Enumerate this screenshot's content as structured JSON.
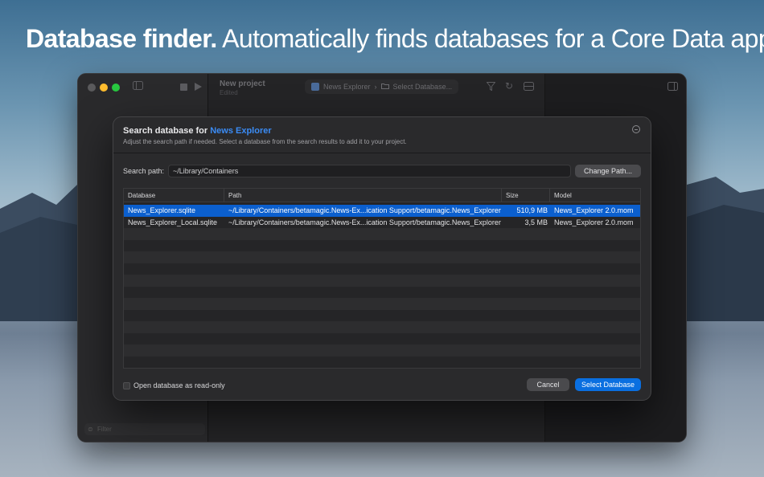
{
  "headline": {
    "bold": "Database finder.",
    "rest": "Automatically finds databases for a Core Data app."
  },
  "window": {
    "project_title": "New project",
    "project_status": "Edited",
    "breadcrumb_app": "News Explorer",
    "breadcrumb_page": "Select Database...",
    "filter_placeholder": "Filter",
    "ghost_text": "ed"
  },
  "sheet": {
    "title_prefix": "Search database for",
    "title_app": "News Explorer",
    "description": "Adjust the search path if needed. Select a database from the search results to add it to your project.",
    "search_label": "Search path:",
    "search_value": "~/Library/Containers",
    "change_path_label": "Change Path...",
    "columns": [
      "Database",
      "Path",
      "Size",
      "Model"
    ],
    "rows": [
      {
        "database": "News_Explorer.sqlite",
        "path": "~/Library/Containers/betamagic.News-Ex...ication Support/betamagic.News_Explorer",
        "size": "510,9 MB",
        "model": "News_Explorer 2.0.mom"
      },
      {
        "database": "News_Explorer_Local.sqlite",
        "path": "~/Library/Containers/betamagic.News-Ex...ication Support/betamagic.News_Explorer",
        "size": "3,5 MB",
        "model": "News_Explorer 2.0.mom"
      }
    ],
    "readonly_label": "Open database as read-only",
    "readonly_checked": false,
    "cancel_label": "Cancel",
    "select_label": "Select Database"
  },
  "colors": {
    "accent": "#0a6fe0",
    "selection": "#0b5fce",
    "title_accent": "#3b8cf5"
  }
}
